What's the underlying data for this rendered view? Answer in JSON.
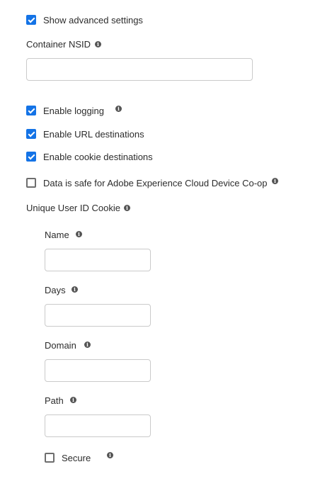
{
  "advanced": {
    "show_advanced_label": "Show advanced settings",
    "show_advanced_checked": true
  },
  "container_nsid": {
    "label": "Container NSID",
    "value": "",
    "placeholder": ""
  },
  "options": {
    "enable_logging": {
      "label": "Enable logging",
      "checked": true
    },
    "enable_url_destinations": {
      "label": "Enable URL destinations",
      "checked": true
    },
    "enable_cookie_destinations": {
      "label": "Enable cookie destinations",
      "checked": true
    },
    "device_coop": {
      "label": "Data is safe for Adobe Experience Cloud Device Co-op",
      "checked": false
    }
  },
  "unique_user_id_cookie": {
    "label": "Unique User ID Cookie",
    "name": {
      "label": "Name",
      "value": ""
    },
    "days": {
      "label": "Days",
      "value": ""
    },
    "domain": {
      "label": "Domain",
      "value": ""
    },
    "path": {
      "label": "Path",
      "value": ""
    },
    "secure": {
      "label": "Secure",
      "checked": false
    }
  },
  "icons": {
    "info": "info-icon",
    "info_glyph": "i",
    "checkbox_color": "#1473e6"
  }
}
